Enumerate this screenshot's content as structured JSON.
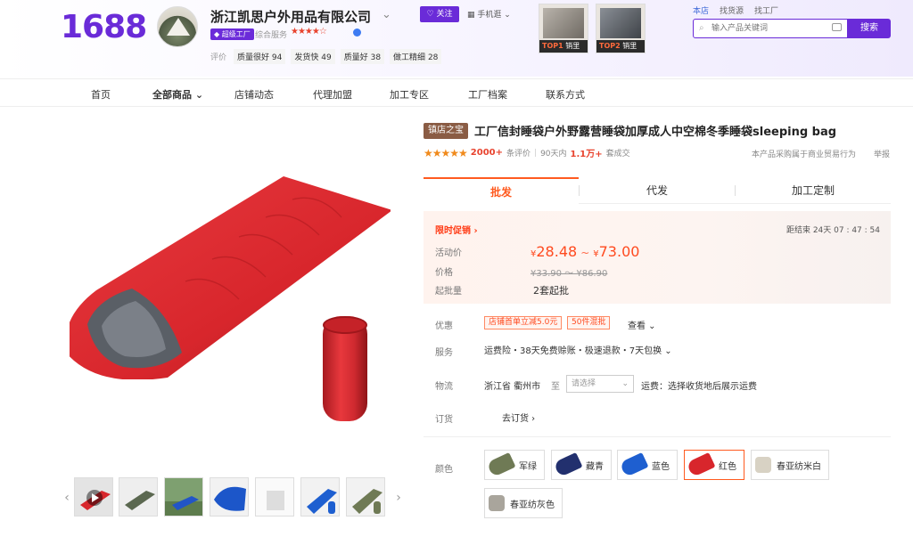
{
  "header": {
    "logo": "1688",
    "shop_name": "浙江凯思户外用品有限公司",
    "factory_badge": "超级工厂",
    "service_label": "综合服务",
    "service_stars": "★★★★☆",
    "ratings_label": "评价",
    "ratings": [
      {
        "label": "质量很好",
        "count": "94"
      },
      {
        "label": "发货快",
        "count": "49"
      },
      {
        "label": "质量好",
        "count": "38"
      },
      {
        "label": "做工精细",
        "count": "28"
      }
    ],
    "follow_label": "关注",
    "mobile_label": "手机逛",
    "top_products": [
      {
        "rank": "TOP1",
        "caption": "销里"
      },
      {
        "rank": "TOP2",
        "caption": "销里"
      }
    ],
    "search_tabs": [
      "本店",
      "找货源",
      "找工厂"
    ],
    "search_placeholder": "输入产品关键词",
    "search_button": "搜索"
  },
  "nav": {
    "items": [
      "首页",
      "全部商品",
      "店铺动态",
      "代理加盟",
      "加工专区",
      "工厂档案",
      "联系方式"
    ]
  },
  "product": {
    "badge": "镇店之宝",
    "title": "工厂信封睡袋户外野露营睡袋加厚成人中空棉冬季睡袋sleeping bag",
    "stars": "★★★★★",
    "review_count": "2000+",
    "review_label": "条评价",
    "sales_prefix": "90天内",
    "sales_count": "1.1万+",
    "sales_suffix": "套成交",
    "trade_note": "本产品采购属于商业贸易行为",
    "report": "举报"
  },
  "tabs": [
    "批发",
    "代发",
    "加工定制"
  ],
  "promo": {
    "title": "限时促销 ›",
    "countdown": "距结束  24天  07 : 47 : 54",
    "active_price_label": "活动价",
    "currency": "¥",
    "price_low": "28.48",
    "price_high": "73.00",
    "price_label": "价格",
    "old_price": "¥33.90 ～ ¥86.90",
    "moq_label": "起批量",
    "moq_value": "2套起批"
  },
  "info": {
    "discount_label": "优惠",
    "coupons": [
      "店铺首单立减5.0元",
      "50件混批"
    ],
    "view_more": "查看 ⌄",
    "service_label": "服务",
    "service_value": "运费险・38天免费赊账・极速退款・7天包换 ⌄",
    "logistics_label": "物流",
    "logistics_province": "浙江省",
    "logistics_city": "衢州市",
    "logistics_to": "至",
    "logistics_select": "请选择",
    "logistics_fee": "运费：选择收货地后展示运费",
    "order_label": "订货",
    "order_link": "去订货 ›"
  },
  "colors": {
    "label": "颜色",
    "options": [
      {
        "name": "军绿",
        "color": "#6f7a55"
      },
      {
        "name": "藏青",
        "color": "#22306e"
      },
      {
        "name": "蓝色",
        "color": "#1e5fd0"
      },
      {
        "name": "红色",
        "color": "#d8262c"
      },
      {
        "name": "春亚纺米白",
        "color": "#d8d2c4"
      },
      {
        "name": "春亚纺灰色",
        "color": "#a9a59c"
      }
    ],
    "selected": "红色"
  },
  "palette": {
    "brand": "#6a2bd8",
    "price": "#ff4a1f",
    "product_red": "#d8262c"
  }
}
